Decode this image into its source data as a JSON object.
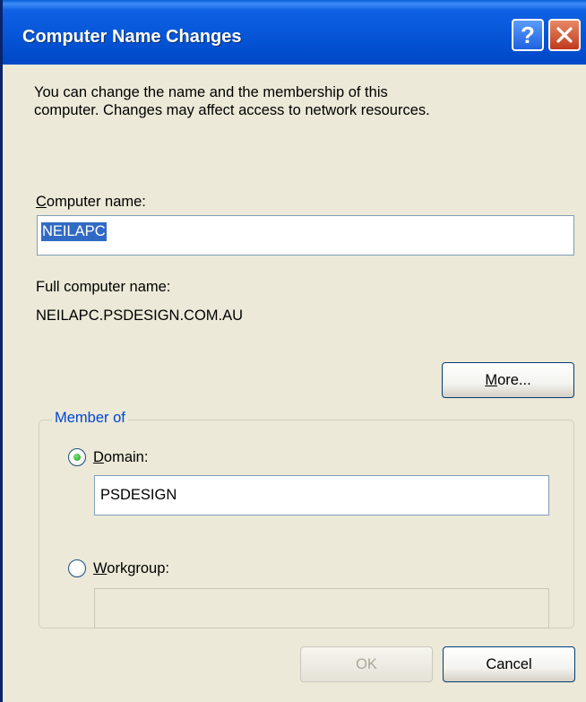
{
  "window": {
    "title": "Computer Name Changes",
    "help_label": "?",
    "close_icon": "close-icon"
  },
  "intro": {
    "line1": "You can change the name and the membership of this",
    "line2": "computer. Changes may affect access to network resources."
  },
  "computer_name": {
    "label_mnemonic": "C",
    "label_rest": "omputer name:",
    "value": "NEILAPC"
  },
  "full_name": {
    "label": "Full computer name:",
    "value": "NEILAPC.PSDESIGN.COM.AU"
  },
  "more_button": {
    "mnemonic": "M",
    "rest": "ore..."
  },
  "member_of": {
    "legend": "Member of",
    "selected": "domain",
    "domain": {
      "label_mnemonic": "D",
      "label_rest": "omain:",
      "value": "PSDESIGN"
    },
    "workgroup": {
      "label_mnemonic": "W",
      "label_rest": "orkgroup:",
      "value": ""
    }
  },
  "buttons": {
    "ok": "OK",
    "cancel": "Cancel"
  },
  "colors": {
    "title_bar": "#0554d6",
    "dialog_bg": "#ece9d8",
    "group_legend": "#0046d5",
    "selection": "#316ac5",
    "radio_dot": "#1f9e1f"
  }
}
